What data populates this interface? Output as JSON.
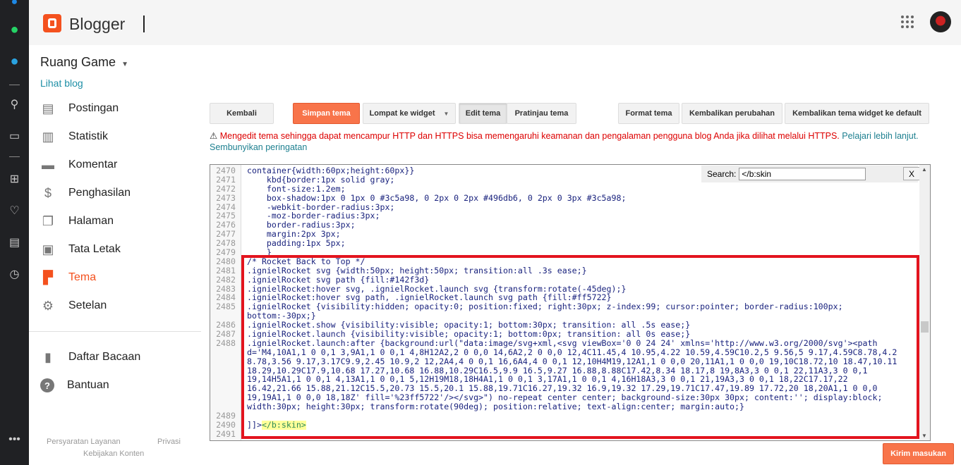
{
  "header": {
    "brand": "Blogger"
  },
  "sidebar": {
    "blog_name": "Ruang Game",
    "view_blog": "Lihat blog",
    "items": [
      {
        "label": "Postingan",
        "icon": "posts-icon"
      },
      {
        "label": "Statistik",
        "icon": "stats-icon"
      },
      {
        "label": "Komentar",
        "icon": "comment-icon"
      },
      {
        "label": "Penghasilan",
        "icon": "dollar-icon"
      },
      {
        "label": "Halaman",
        "icon": "pages-icon"
      },
      {
        "label": "Tata Letak",
        "icon": "layout-icon"
      },
      {
        "label": "Tema",
        "icon": "theme-icon"
      },
      {
        "label": "Setelan",
        "icon": "gear-icon"
      }
    ],
    "secondary": [
      {
        "label": "Daftar Bacaan",
        "icon": "bookmark-icon"
      },
      {
        "label": "Bantuan",
        "icon": "help-icon"
      }
    ],
    "footer": {
      "terms": "Persyaratan Layanan",
      "privacy": "Privasi",
      "content_policy": "Kebijakan Konten"
    }
  },
  "toolbar": {
    "back": "Kembali",
    "save": "Simpan tema",
    "jump": "Lompat ke widget",
    "edit": "Edit tema",
    "preview": "Pratinjau tema",
    "format": "Format tema",
    "revert": "Kembalikan perubahan",
    "revert_widgets": "Kembalikan tema widget ke default"
  },
  "warning": {
    "text": "Mengedit tema sehingga dapat mencampur HTTP dan HTTPS bisa memengaruhi keamanan dan pengalaman pengguna blog Anda jika dilihat melalui HTTPS.",
    "learn_more": "Pelajari lebih lanjut.",
    "hide": "Sembunyikan peringatan"
  },
  "search": {
    "label": "Search:",
    "value": "</b:skin",
    "close": "X"
  },
  "code": [
    {
      "n": "2470",
      "rows": [
        "container{width:60px;height:60px}}"
      ]
    },
    {
      "n": "2471",
      "rows": [
        "    kbd{border:1px solid gray;"
      ]
    },
    {
      "n": "2472",
      "rows": [
        "    font-size:1.2em;"
      ]
    },
    {
      "n": "2473",
      "rows": [
        "    box-shadow:1px 0 1px 0 #3c5a98, 0 2px 0 2px #496db6, 0 2px 0 3px #3c5a98;"
      ]
    },
    {
      "n": "2474",
      "rows": [
        "    -webkit-border-radius:3px;"
      ]
    },
    {
      "n": "2475",
      "rows": [
        "    -moz-border-radius:3px;"
      ]
    },
    {
      "n": "2476",
      "rows": [
        "    border-radius:3px;"
      ]
    },
    {
      "n": "2477",
      "rows": [
        "    margin:2px 3px;"
      ]
    },
    {
      "n": "2478",
      "rows": [
        "    padding:1px 5px;"
      ]
    },
    {
      "n": "2479",
      "rows": [
        "    }"
      ]
    },
    {
      "n": "2480",
      "rows": [
        "/* Rocket Back to Top */"
      ]
    },
    {
      "n": "2481",
      "rows": [
        ".ignielRocket svg {width:50px; height:50px; transition:all .3s ease;}"
      ]
    },
    {
      "n": "2482",
      "rows": [
        ".ignielRocket svg path {fill:#142f3d}"
      ]
    },
    {
      "n": "2483",
      "rows": [
        ".ignielRocket:hover svg, .ignielRocket.launch svg {transform:rotate(-45deg);}"
      ]
    },
    {
      "n": "2484",
      "rows": [
        ".ignielRocket:hover svg path, .ignielRocket.launch svg path {fill:#ff5722}"
      ]
    },
    {
      "n": "2485",
      "rows": [
        ".ignielRocket {visibility:hidden; opacity:0; position:fixed; right:30px; z-index:99; cursor:pointer; border-radius:100px;",
        "bottom:-30px;}"
      ]
    },
    {
      "n": "2486",
      "rows": [
        ".ignielRocket.show {visibility:visible; opacity:1; bottom:30px; transition: all .5s ease;}"
      ]
    },
    {
      "n": "2487",
      "rows": [
        ".ignielRocket.launch {visibility:visible; opacity:1; bottom:0px; transition: all 0s ease;}"
      ]
    },
    {
      "n": "2488",
      "rows": [
        ".ignielRocket.launch:after {background:url(\"data:image/svg+xml,<svg viewBox='0 0 24 24' xmlns='http://www.w3.org/2000/svg'><path",
        "d='M4,10A1,1 0 0,1 3,9A1,1 0 0,1 4,8H12A2,2 0 0,0 14,6A2,2 0 0,0 12,4C11.45,4 10.95,4.22 10.59,4.59C10.2,5 9.56,5 9.17,4.59C8.78,4.2",
        "8.78,3.56 9.17,3.17C9.9,2.45 10.9,2 12,2A4,4 0 0,1 16,6A4,4 0 0,1 12,10H4M19,12A1,1 0 0,0 20,11A1,1 0 0,0 19,10C18.72,10 18.47,10.11",
        "18.29,10.29C17.9,10.68 17.27,10.68 16.88,10.29C16.5,9.9 16.5,9.27 16.88,8.88C17.42,8.34 18.17,8 19,8A3,3 0 0,1 22,11A3,3 0 0,1",
        "19,14H5A1,1 0 0,1 4,13A1,1 0 0,1 5,12H19M18,18H4A1,1 0 0,1 3,17A1,1 0 0,1 4,16H18A3,3 0 0,1 21,19A3,3 0 0,1 18,22C17.17,22",
        "16.42,21.66 15.88,21.12C15.5,20.73 15.5,20.1 15.88,19.71C16.27,19.32 16.9,19.32 17.29,19.71C17.47,19.89 17.72,20 18,20A1,1 0 0,0",
        "19,19A1,1 0 0,0 18,18Z' fill='%23ff5722'/></svg>\") no-repeat center center; background-size:30px 30px; content:''; display:block;",
        "width:30px; height:30px; transform:rotate(90deg); position:relative; text-align:center; margin:auto;}"
      ]
    },
    {
      "n": "2489",
      "rows": [
        ""
      ]
    },
    {
      "n": "2490",
      "rows": [
        "]]>"
      ],
      "hl": "</b:skin>"
    },
    {
      "n": "2491",
      "rows": [
        ""
      ]
    }
  ],
  "feedback": "Kirim masukan"
}
